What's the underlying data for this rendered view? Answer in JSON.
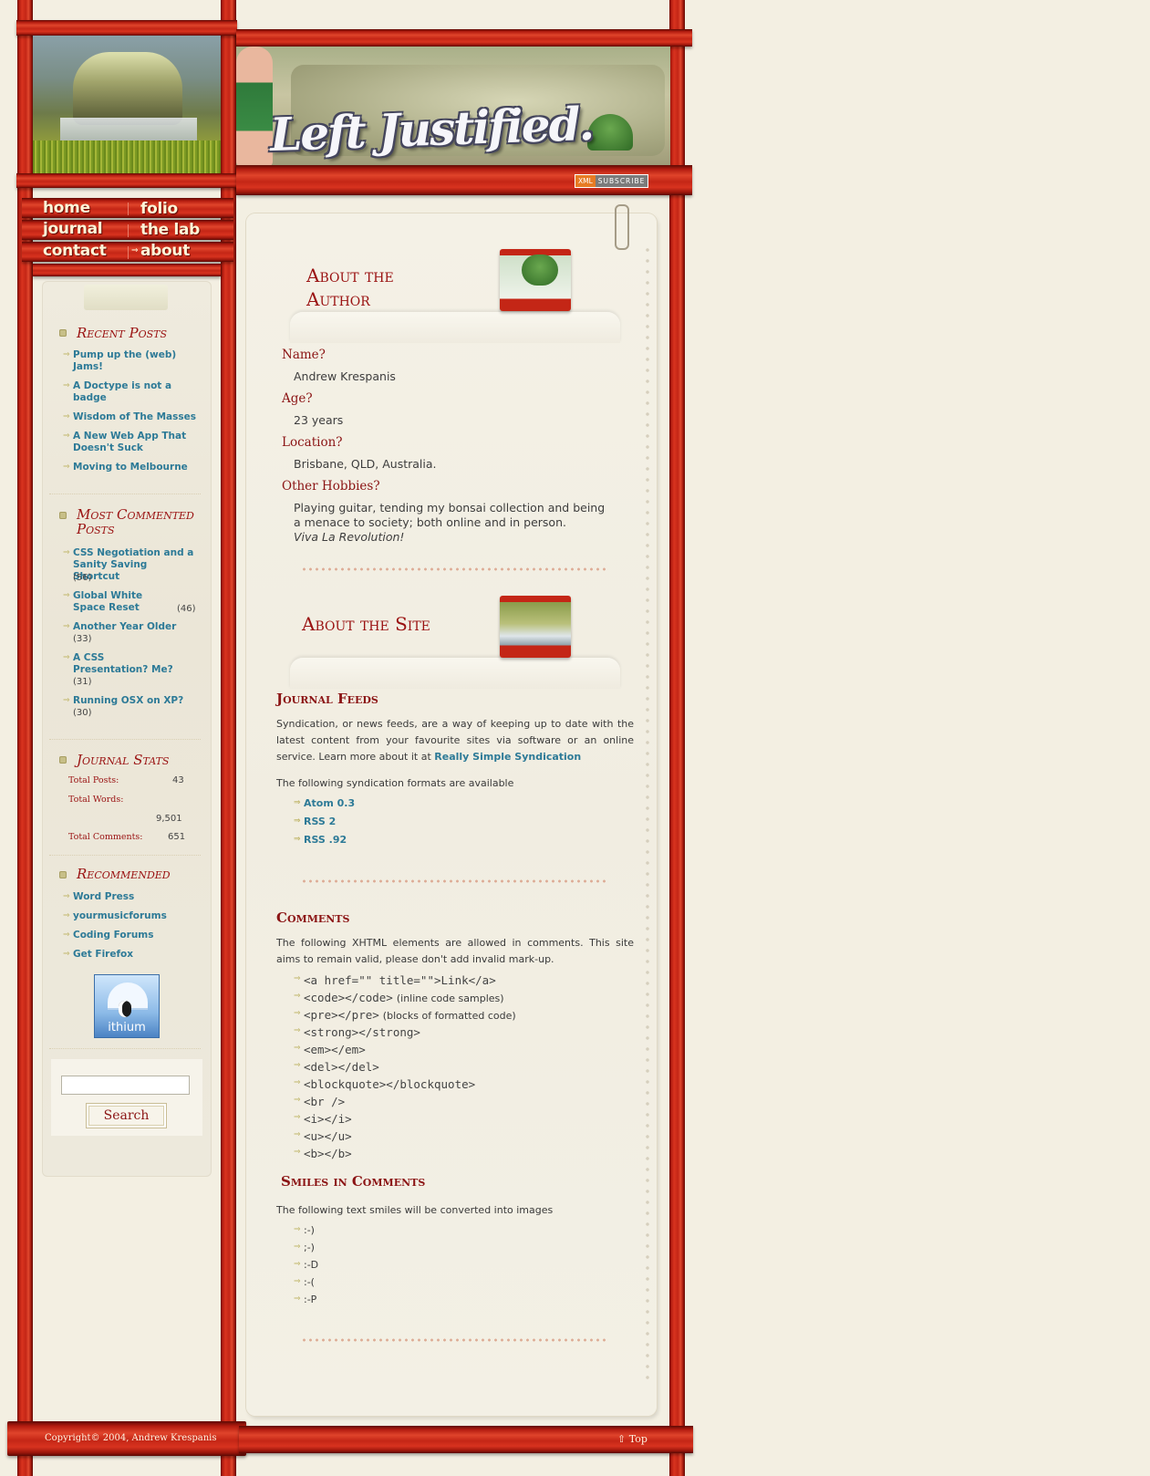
{
  "header": {
    "logo_text": "Left Justified.",
    "xml_badge_left": "XML",
    "xml_badge_right": "SUBSCRIBE"
  },
  "nav": {
    "home": "home",
    "folio": "folio",
    "journal": "journal",
    "the_lab": "the lab",
    "contact": "contact",
    "about": "about"
  },
  "sidebar": {
    "recent_posts": {
      "title": "Recent Posts",
      "items": [
        "Pump up the (web) Jams!",
        "A Doctype is not a badge",
        "Wisdom of The Masses",
        "A New Web App That Doesn't Suck",
        "Moving to Melbourne"
      ]
    },
    "most_commented": {
      "title": "Most Commented Posts",
      "items": [
        {
          "title": "CSS Negotiation and a Sanity Saving Shortcut",
          "count": "(56)"
        },
        {
          "title": "Global White Space Reset",
          "count": "(46)"
        },
        {
          "title": "Another Year Older",
          "count": "(33)"
        },
        {
          "title": "A CSS Presentation? Me?",
          "count": "(31)"
        },
        {
          "title": "Running OSX on XP?",
          "count": "(30)"
        }
      ]
    },
    "journal_stats": {
      "title": "Journal Stats",
      "total_posts_label": "Total Posts:",
      "total_posts": "43",
      "total_words_label": "Total Words:",
      "total_words": "9,501",
      "total_comments_label": "Total Comments:",
      "total_comments": "651"
    },
    "recommended": {
      "title": "Recommended",
      "items": [
        "Word Press",
        "yourmusicforums",
        "Coding Forums",
        "Get Firefox"
      ],
      "badge_text": "ithium"
    },
    "search": {
      "value": "",
      "button": "Search"
    }
  },
  "main": {
    "about_author": {
      "title_line1": "About the",
      "title_line2": "Author",
      "name_label": "Name?",
      "name": "Andrew Krespanis",
      "age_label": "Age?",
      "age": "23 years",
      "location_label": "Location?",
      "location": "Brisbane, QLD, Australia.",
      "hobbies_label": "Other Hobbies?",
      "hobbies_line1": "Playing guitar, tending my bonsai collection and being",
      "hobbies_line2": "a menace to society; both online and in person.",
      "hobbies_line3": "Viva La Revolution!"
    },
    "about_site": {
      "title": "About the Site",
      "feeds_heading": "Journal Feeds",
      "feeds_para": "Syndication, or news feeds, are a way of keeping up to date with the latest content from your favourite sites via software or an online service. Learn more about it at",
      "feeds_link": "Really Simple Syndication",
      "formats_intro": "The following syndication formats are available",
      "formats": [
        "Atom 0.3",
        "RSS 2",
        "RSS .92"
      ],
      "comments_heading": "Comments",
      "comments_para": "The following XHTML elements are allowed in comments. This site aims to remain valid, please don't add invalid mark-up.",
      "elements": [
        {
          "code": "<a href=\"\" title=\"\">Link</a>",
          "note": ""
        },
        {
          "code": "<code></code>",
          "note": "(inline code samples)"
        },
        {
          "code": "<pre></pre>",
          "note": "(blocks of formatted code)"
        },
        {
          "code": "<strong></strong>",
          "note": ""
        },
        {
          "code": "<em></em>",
          "note": ""
        },
        {
          "code": "<del></del>",
          "note": ""
        },
        {
          "code": "<blockquote></blockquote>",
          "note": ""
        },
        {
          "code": "<br />",
          "note": ""
        },
        {
          "code": "<i></i>",
          "note": ""
        },
        {
          "code": "<u></u>",
          "note": ""
        },
        {
          "code": "<b></b>",
          "note": ""
        }
      ],
      "smiles_heading": "Smiles in Comments",
      "smiles_intro": "The following text smiles will be converted into images",
      "smiles": [
        ":-)",
        ";-)",
        ":-D",
        ":-(",
        ":-P"
      ]
    }
  },
  "footer": {
    "copyright": "Copyright© 2004, Andrew Krespanis",
    "top_link": "Top"
  },
  "colors": {
    "accent_red": "#9a1212",
    "link_blue": "#2d7a97",
    "background_cream": "#f3efe2"
  }
}
